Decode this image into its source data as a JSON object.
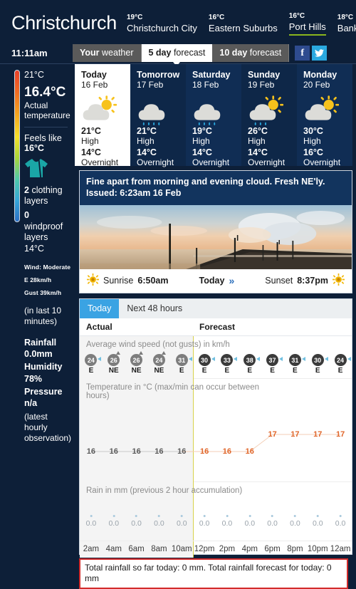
{
  "header": {
    "city": "Christchurch",
    "locations": [
      {
        "temp": "19°C",
        "name": "Christchurch City",
        "active": false
      },
      {
        "temp": "16°C",
        "name": "Eastern Suburbs",
        "active": false
      },
      {
        "temp": "16°C",
        "name": "Port Hills",
        "active": true
      },
      {
        "temp": "18°C",
        "name": "Banks Penin",
        "active": false
      }
    ]
  },
  "tabbar": {
    "clock": "11:11am",
    "tabs": [
      {
        "strong": "Your",
        "rest": " weather",
        "selected": false
      },
      {
        "strong": "5 day",
        "rest": " forecast",
        "selected": true
      },
      {
        "strong": "10 day",
        "rest": " forecast",
        "selected": false
      }
    ],
    "facebook_label": "f",
    "twitter_label": "❧"
  },
  "sidebar": {
    "top_temp": "21°C",
    "actual_temp": "16.4°C",
    "actual_label_1": "Actual",
    "actual_label_2": "temperature",
    "feels_like_label": "Feels like",
    "feels_like_value": "16°C",
    "clothing_count": "2",
    "clothing_label": "clothing",
    "clothing_label_2": "layers",
    "windproof_count": "0",
    "windproof_label": "windproof",
    "windproof_label_2": "layers",
    "low_temp": "14°C",
    "wind_line": "Wind: Moderate",
    "wind_speed": "E 28km/h",
    "wind_gust": "Gust 39km/h",
    "in_last_10": "(in last 10",
    "in_last_10b": "minutes)",
    "rainfall_label": "Rainfall",
    "rainfall_value": "0.0mm",
    "humidity_label": "Humidity",
    "humidity_value": "78%",
    "pressure_line": "Pressure n/a",
    "obs_note_1": "(latest hourly",
    "obs_note_2": "observation)"
  },
  "forecast_cards": [
    {
      "day": "Today",
      "date": "16 Feb",
      "icon": "sun-cloud",
      "high": "21°C",
      "high_label": "High",
      "low": "14°C",
      "low_label": "Overnight",
      "selected": true
    },
    {
      "day": "Tomorrow",
      "date": "17 Feb",
      "icon": "rain-cloud",
      "high": "21°C",
      "high_label": "High",
      "low": "14°C",
      "low_label": "Overnight",
      "selected": false
    },
    {
      "day": "Saturday",
      "date": "18 Feb",
      "icon": "rain-cloud",
      "high": "19°C",
      "high_label": "High",
      "low": "14°C",
      "low_label": "Overnight",
      "selected": false
    },
    {
      "day": "Sunday",
      "date": "19 Feb",
      "icon": "sun-rain-cloud",
      "high": "26°C",
      "high_label": "High",
      "low": "14°C",
      "low_label": "Overnight",
      "selected": false
    },
    {
      "day": "Monday",
      "date": "20 Feb",
      "icon": "sun-cloud",
      "high": "30°C",
      "high_label": "High",
      "low": "16°C",
      "low_label": "Overnight",
      "selected": false
    }
  ],
  "summary": {
    "line1": "Fine apart from morning and evening cloud. Fresh NE'ly.",
    "line2": "Issued: 6:23am 16 Feb",
    "photo_alt": "pier-at-sunrise-photo",
    "sunrise_label": "Sunrise",
    "sunrise_value": "6:50am",
    "today_label": "Today",
    "chevron": "»",
    "sunset_label": "Sunset",
    "sunset_value": "8:37pm"
  },
  "chart_panel": {
    "sub_tabs": [
      {
        "label": "Today",
        "selected": true
      },
      {
        "label": "Next 48 hours",
        "selected": false
      }
    ],
    "section_actual": "Actual",
    "section_forecast": "Forecast",
    "wind_row_label": "Average wind speed (not gusts) in km/h",
    "temp_row_label": "Temperature in °C (max/min can occur between hours)",
    "rain_row_label": "Rain in mm (previous 2 hour accumulation)",
    "rain_total": "Total rainfall so far today: 0 mm. Total rainfall forecast for today: 0 mm"
  },
  "chart_data": {
    "type": "line",
    "title": "Temperature in °C (max/min can occur between hours)",
    "xlabel": "",
    "ylabel": "°C",
    "x": [
      "2am",
      "4am",
      "6am",
      "8am",
      "10am",
      "12pm",
      "2pm",
      "4pm",
      "6pm",
      "8pm",
      "10pm",
      "12am"
    ],
    "ylim": [
      15,
      18
    ],
    "grid": false,
    "legend": "none",
    "actual_count": 5,
    "series": [
      {
        "name": "Temperature (actual)",
        "color": "#5b5b5b",
        "values": [
          16,
          16,
          16,
          16,
          16,
          null,
          null,
          null,
          null,
          null,
          null,
          null
        ]
      },
      {
        "name": "Temperature (forecast)",
        "color": "#e0662a",
        "values": [
          null,
          null,
          null,
          null,
          null,
          16,
          16,
          16,
          17,
          17,
          17,
          17
        ]
      },
      {
        "name": "Average wind speed km/h (actual)",
        "color": "#7d7d7d",
        "values": [
          24,
          26,
          26,
          24,
          31,
          null,
          null,
          null,
          null,
          null,
          null,
          null
        ]
      },
      {
        "name": "Average wind speed km/h (forecast)",
        "color": "#3b3b3b",
        "values": [
          null,
          null,
          null,
          null,
          null,
          30,
          33,
          38,
          37,
          31,
          30,
          24
        ]
      },
      {
        "name": "Wind direction",
        "color": "#1b1b1b",
        "values": [
          "E",
          "NE",
          "NE",
          "NE",
          "E",
          "E",
          "E",
          "E",
          "E",
          "E",
          "E",
          "E"
        ]
      },
      {
        "name": "Rain in mm (previous 2 hour accumulation)",
        "color": "#9aa3ab",
        "values": [
          0.0,
          0.0,
          0.0,
          0.0,
          0.0,
          0.0,
          0.0,
          0.0,
          0.0,
          0.0,
          0.0,
          0.0
        ]
      }
    ]
  }
}
